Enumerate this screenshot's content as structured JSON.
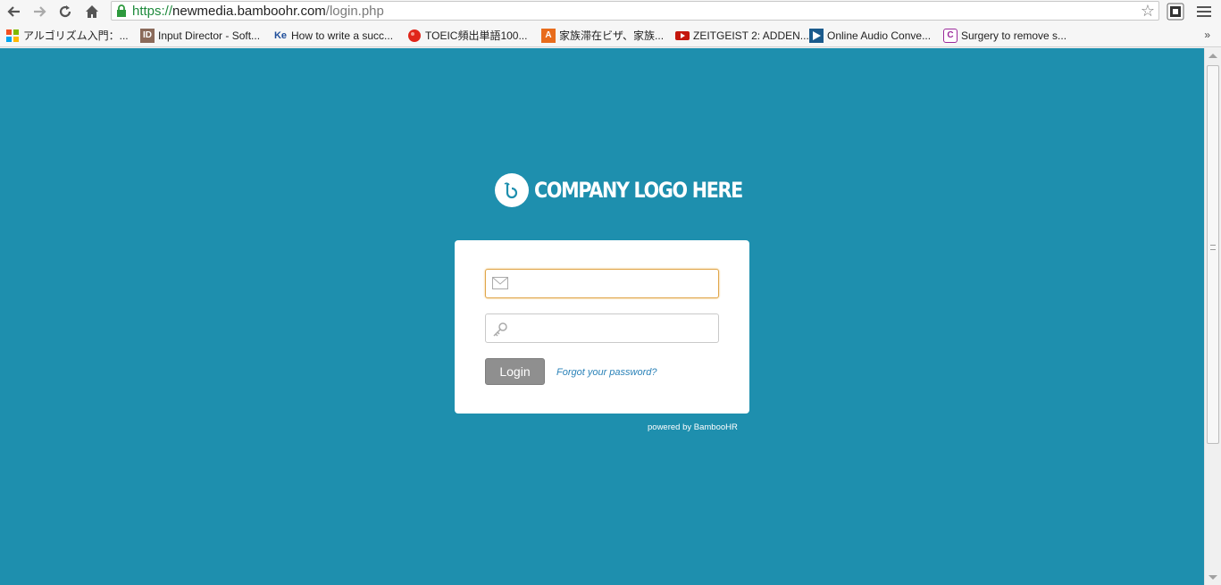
{
  "browser": {
    "url_scheme": "https://",
    "url_host": "newmedia.bamboohr.com",
    "url_path": "/login.php"
  },
  "bookmarks": [
    {
      "label": "アルゴリズム入門：...",
      "icon": "windows-icon"
    },
    {
      "label": "Input Director - Soft...",
      "icon": "id-icon"
    },
    {
      "label": "How to write a succ...",
      "icon": "ke-icon"
    },
    {
      "label": "TOEIC頻出単語100...",
      "icon": "red-ball-icon"
    },
    {
      "label": "家族滞在ビザ、家族...",
      "icon": "a-icon"
    },
    {
      "label": "ZEITGEIST 2: ADDEN...",
      "icon": "youtube-icon"
    },
    {
      "label": "Online Audio Conve...",
      "icon": "play-icon"
    },
    {
      "label": "Surgery to remove s...",
      "icon": "c-icon"
    }
  ],
  "bookmarks_more": "»",
  "page": {
    "logo_text": "COMPANY LOGO HERE",
    "login_button": "Login",
    "forgot_link": "Forgot your password?",
    "powered_by": "powered by BambooHR",
    "background_color": "#1e8fae"
  }
}
